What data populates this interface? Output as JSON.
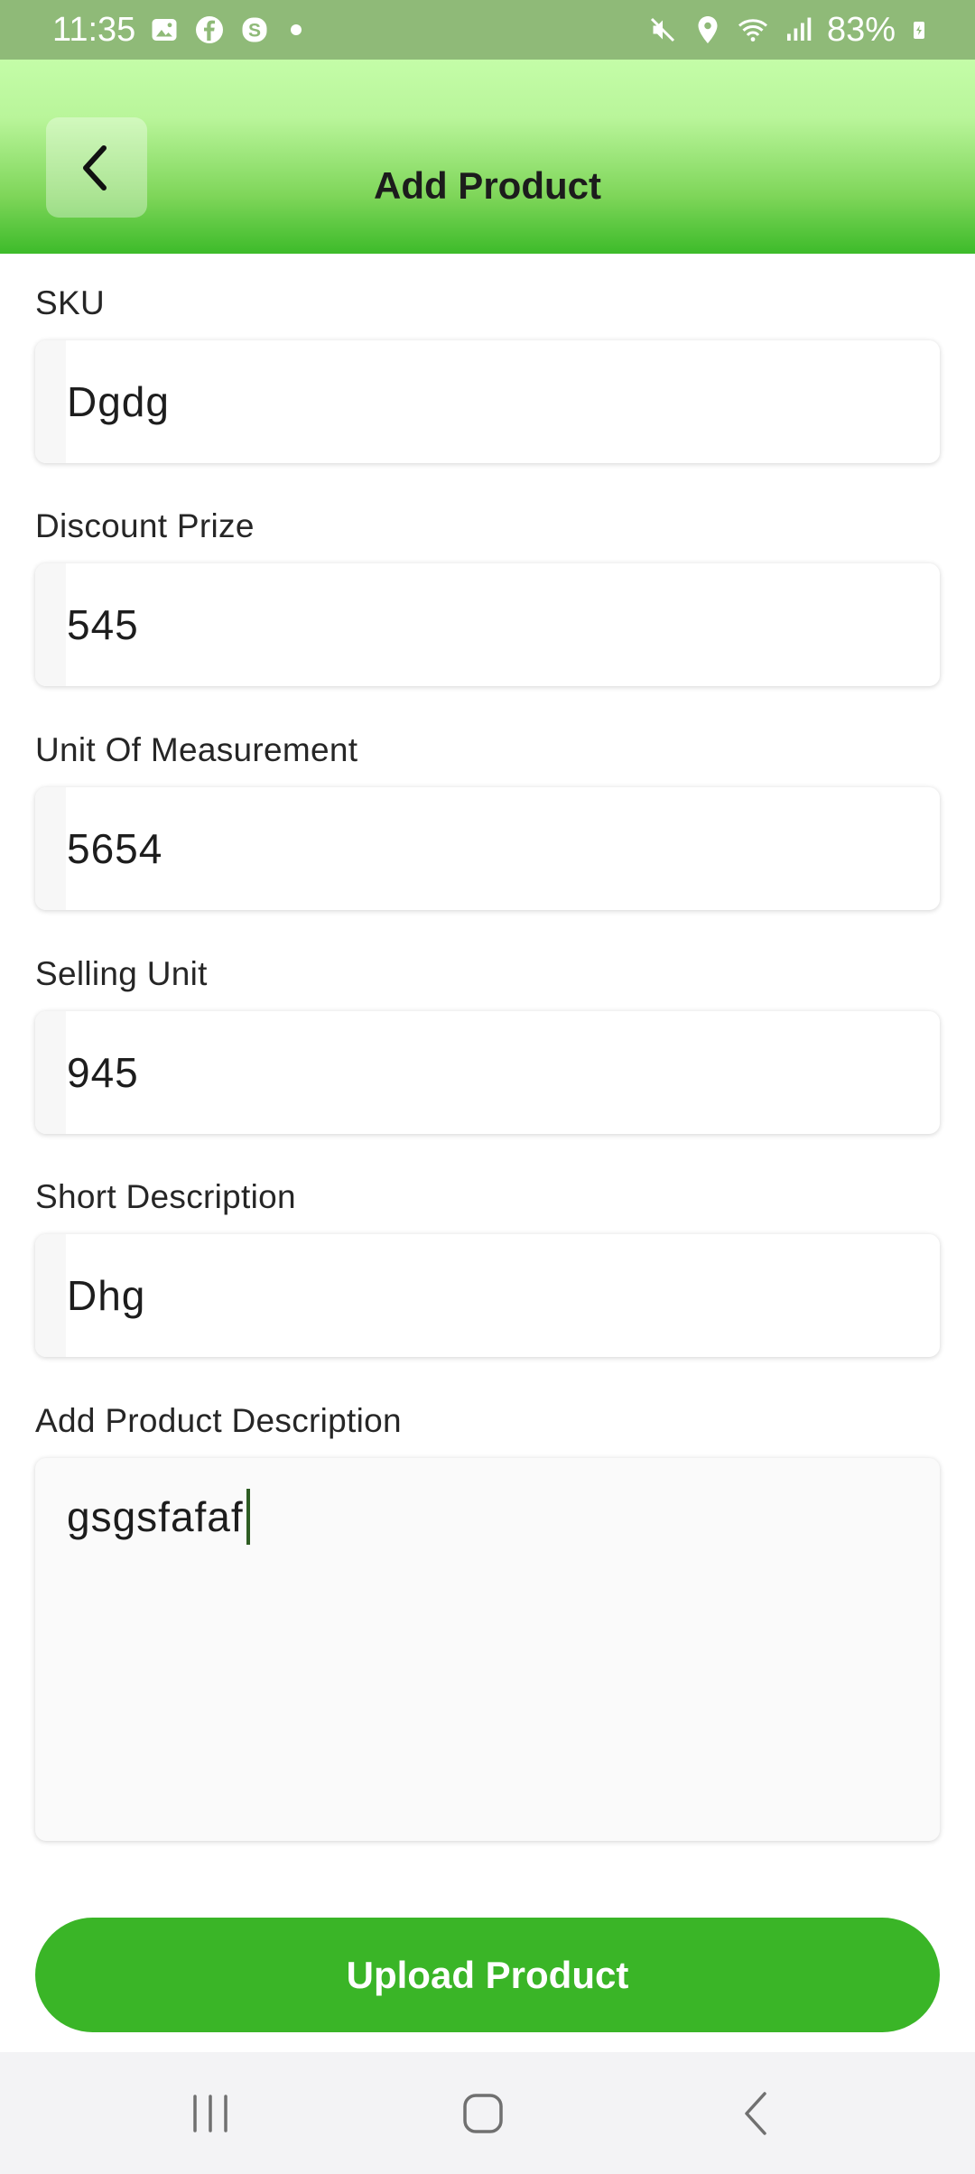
{
  "status_bar": {
    "time": "11:35",
    "battery": "83%"
  },
  "header": {
    "title": "Add Product"
  },
  "form": {
    "fields": [
      {
        "label": "SKU",
        "value": "Dgdg"
      },
      {
        "label": "Discount Prize",
        "value": "545"
      },
      {
        "label": "Unit Of Measurement",
        "value": "5654"
      },
      {
        "label": "Selling Unit",
        "value": "945"
      },
      {
        "label": "Short Description",
        "value": "Dhg"
      }
    ],
    "description": {
      "label": "Add Product Description",
      "value": "gsgsfafaf"
    }
  },
  "actions": {
    "upload_label": "Upload Product"
  },
  "colors": {
    "accent_green": "#3ab527",
    "status_bar": "#8fba78"
  }
}
